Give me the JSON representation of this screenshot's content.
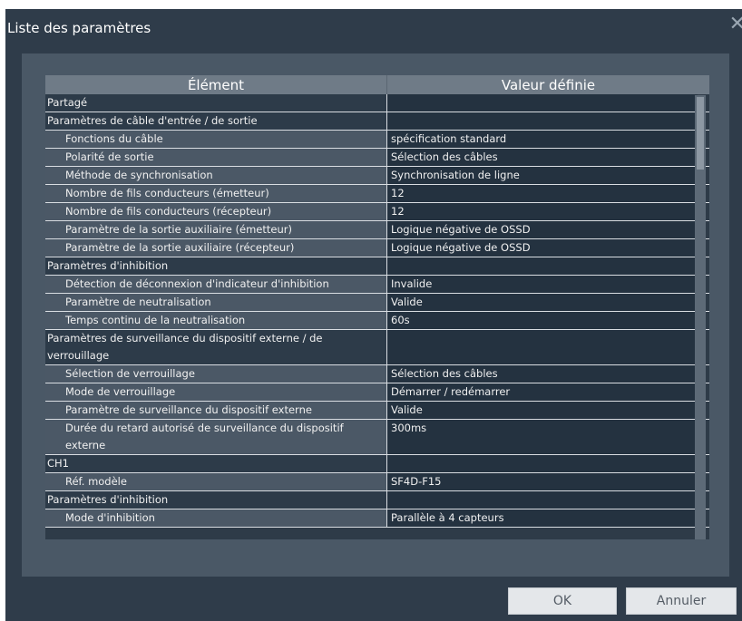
{
  "dialog": {
    "title": "Liste des paramètres",
    "close_glyph": "✕",
    "ok_label": "OK",
    "cancel_label": "Annuler"
  },
  "table": {
    "headers": [
      "Élément",
      "Valeur définie"
    ],
    "rows": [
      {
        "type": "sec",
        "label": "Partagé",
        "value": ""
      },
      {
        "type": "sec",
        "label": "Paramètres de câble d'entrée / de sortie",
        "value": ""
      },
      {
        "type": "item",
        "label": "Fonctions du câble",
        "value": "spécification standard"
      },
      {
        "type": "item",
        "label": "Polarité de sortie",
        "value": "Sélection des câbles"
      },
      {
        "type": "item",
        "label": "Méthode de synchronisation",
        "value": "Synchronisation de ligne"
      },
      {
        "type": "item",
        "label": "Nombre de fils conducteurs (émetteur)",
        "value": "12"
      },
      {
        "type": "item",
        "label": "Nombre de fils conducteurs (récepteur)",
        "value": "12"
      },
      {
        "type": "item",
        "label": "Paramètre de la sortie auxiliaire (émetteur)",
        "value": "Logique négative de OSSD"
      },
      {
        "type": "item",
        "label": "Paramètre de la sortie auxiliaire (récepteur)",
        "value": "Logique négative de OSSD"
      },
      {
        "type": "sec",
        "label": "Paramètres d'inhibition",
        "value": ""
      },
      {
        "type": "item",
        "label": "Détection de déconnexion d'indicateur d'inhibition",
        "value": "Invalide"
      },
      {
        "type": "item",
        "label": "Paramètre de neutralisation",
        "value": "Valide"
      },
      {
        "type": "item",
        "label": "Temps continu de la neutralisation",
        "value": "60s"
      },
      {
        "type": "sec",
        "label": "Paramètres de surveillance du dispositif externe / de verrouillage",
        "value": ""
      },
      {
        "type": "item",
        "label": "Sélection de verrouillage",
        "value": "Sélection des câbles"
      },
      {
        "type": "item",
        "label": "Mode de verrouillage",
        "value": "Démarrer / redémarrer"
      },
      {
        "type": "item",
        "label": "Paramètre de surveillance du dispositif externe",
        "value": "Valide"
      },
      {
        "type": "item",
        "label": "Durée du retard autorisé de surveillance du dispositif externe",
        "value": "300ms"
      },
      {
        "type": "sec",
        "label": "CH1",
        "value": ""
      },
      {
        "type": "item",
        "label": "Réf. modèle",
        "value": "SF4D-F15"
      },
      {
        "type": "sec",
        "label": "Paramètres d'inhibition",
        "value": ""
      },
      {
        "type": "item",
        "label": "Mode d'inhibition",
        "value": "Parallèle à 4 capteurs"
      }
    ]
  }
}
